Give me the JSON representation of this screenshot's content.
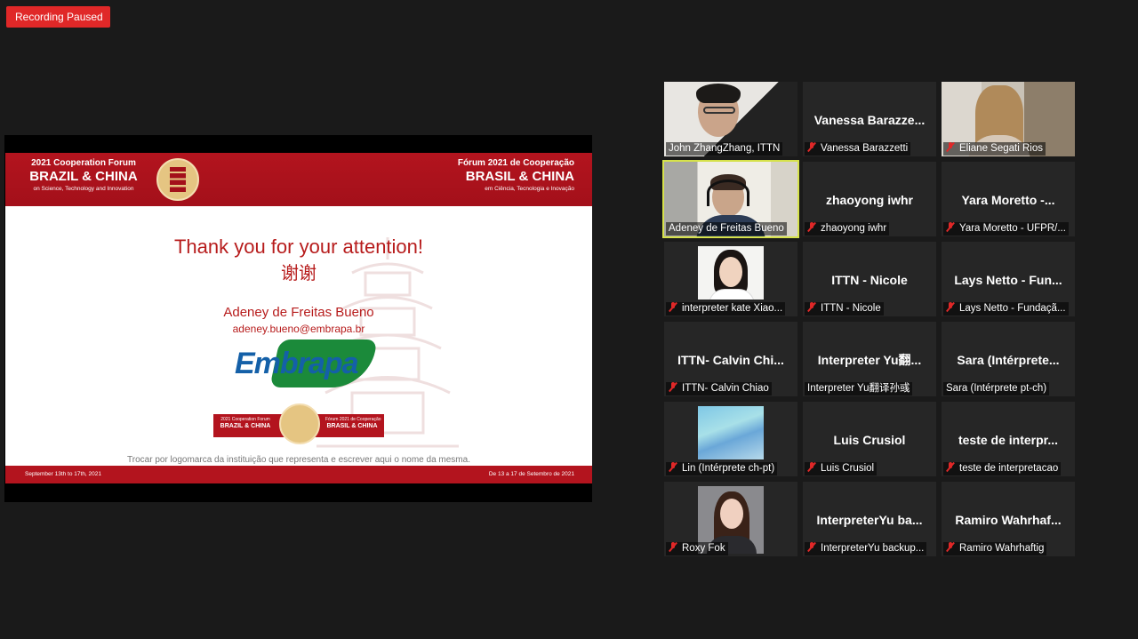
{
  "recording": {
    "status": "Recording Paused"
  },
  "slide": {
    "header_left": {
      "line1": "2021 Cooperation Forum",
      "line2": "BRAZIL & CHINA",
      "line3": "on Science, Technology and Innovation"
    },
    "header_right": {
      "line1": "Fórum 2021 de Cooperação",
      "line2": "BRASIL & CHINA",
      "line3": "em Ciência, Tecnologia e Inovação"
    },
    "thanks": "Thank you for your attention!",
    "thanks_chinese": "谢谢",
    "speaker_name": "Adeney de Freitas Bueno",
    "speaker_email": "adeney.bueno@embrapa.br",
    "logo_text": "Embrapa",
    "placeholder_note": "Trocar por logomarca da instituição que representa e escrever aqui o nome da mesma.",
    "footer_left": "September 13th to 17th, 2021",
    "footer_right": "De 13 a 17 de Setembro de 2021"
  },
  "gallery": {
    "tiles": [
      {
        "display": "",
        "label": "John ZhangZhang, ITTN",
        "muted": false,
        "video": "john"
      },
      {
        "display": "Vanessa  Barazze...",
        "label": "Vanessa Barazzetti",
        "muted": true
      },
      {
        "display": "",
        "label": "Eliane Segati Rios",
        "muted": true,
        "video": "eliane"
      },
      {
        "display": "",
        "label": "Adeney de Freitas Bueno",
        "muted": false,
        "video": "adeney",
        "active": true
      },
      {
        "display": "zhaoyong  iwhr",
        "label": "zhaoyong  iwhr",
        "muted": true
      },
      {
        "display": "Yara Moretto -...",
        "label": "Yara Moretto - UFPR/...",
        "muted": true
      },
      {
        "display": "",
        "label": "interpreter kate Xiao...",
        "muted": true,
        "thumb": "kate"
      },
      {
        "display": "ITTN - Nicole",
        "label": "ITTN - Nicole",
        "muted": true
      },
      {
        "display": "Lays Netto - Fun...",
        "label": "Lays Netto - Fundaçã...",
        "muted": true
      },
      {
        "display": "ITTN- Calvin Chi...",
        "label": "ITTN- Calvin Chiao",
        "muted": true
      },
      {
        "display": "Interpreter  Yu翻...",
        "label": "Interpreter Yu翻译孙彧",
        "muted": false
      },
      {
        "display": "Sara  (Intérprete...",
        "label": "Sara (Intérprete pt-ch)",
        "muted": false
      },
      {
        "display": "",
        "label": "Lin (Intérprete ch-pt)",
        "muted": true,
        "thumb": "lin"
      },
      {
        "display": "Luis Crusiol",
        "label": "Luis Crusiol",
        "muted": true
      },
      {
        "display": "teste de interpr...",
        "label": "teste de interpretacao",
        "muted": true
      },
      {
        "display": "",
        "label": "Roxy Fok",
        "muted": true,
        "thumb": "roxy"
      },
      {
        "display": "InterpreterYu  ba...",
        "label": "InterpreterYu backup...",
        "muted": true
      },
      {
        "display": "Ramiro  Wahrhaf...",
        "label": "Ramiro Wahrhaftig",
        "muted": true
      }
    ]
  },
  "colors": {
    "background": "#1a1a1a",
    "tile": "#262626",
    "recording_badge": "#e02828",
    "muted_icon": "#e02828",
    "active_speaker_border": "#d6e24b",
    "slide_brand_red": "#b3141e"
  }
}
